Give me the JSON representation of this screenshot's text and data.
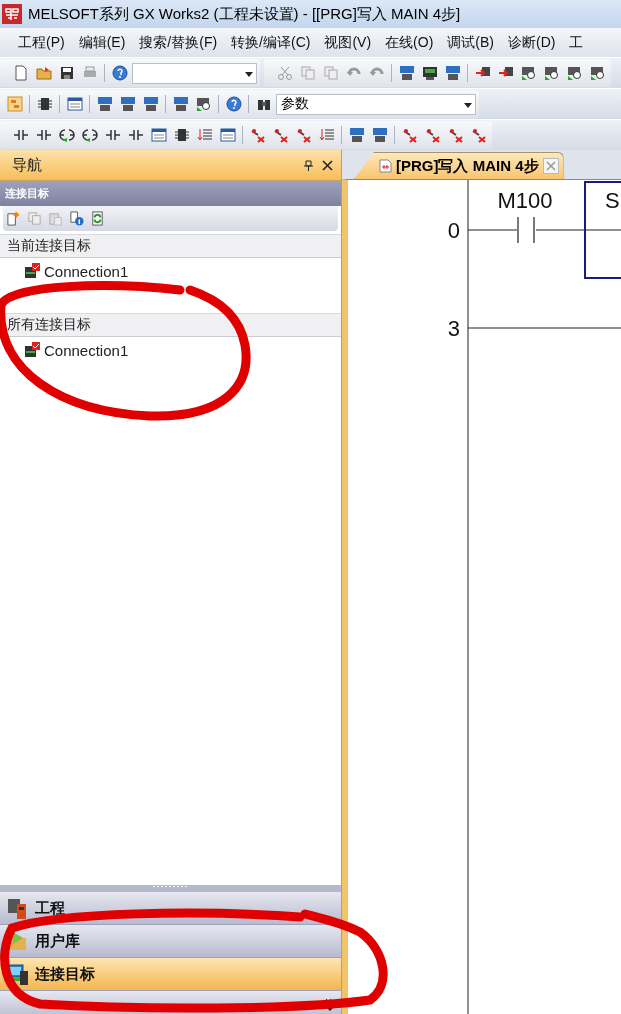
{
  "window": {
    "title": "MELSOFT系列 GX Works2 (工程未设置) - [[PRG]写入 MAIN 4步]"
  },
  "menu": [
    "工程(P)",
    "编辑(E)",
    "搜索/替换(F)",
    "转换/编译(C)",
    "视图(V)",
    "在线(O)",
    "调试(B)",
    "诊断(D)",
    "工"
  ],
  "toolbar": {
    "search_combo": {
      "value": "参数"
    }
  },
  "navigation": {
    "title": "导航",
    "section_title": "连接目标",
    "groups": [
      {
        "title": "当前连接目标",
        "items": [
          {
            "label": "Connection1"
          }
        ]
      },
      {
        "title": "所有连接目标",
        "items": [
          {
            "label": "Connection1"
          }
        ]
      }
    ],
    "views": [
      {
        "kind": "project",
        "label": "工程",
        "selected": false
      },
      {
        "kind": "library",
        "label": "用户库",
        "selected": false
      },
      {
        "kind": "connection",
        "label": "连接目标",
        "selected": true
      }
    ]
  },
  "editor": {
    "tab": {
      "title": "[PRG]写入 MAIN 4步"
    },
    "rungs": [
      {
        "step": "0",
        "contact": "M100",
        "instruction": "S"
      },
      {
        "step": "3"
      }
    ]
  }
}
